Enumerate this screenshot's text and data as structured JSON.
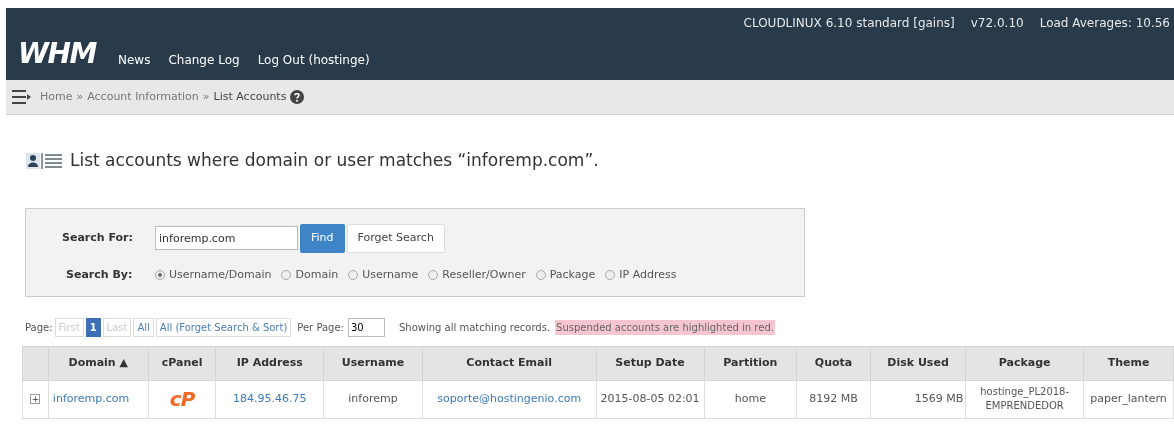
{
  "header": {
    "logo": "WHM",
    "nav": [
      "News",
      "Change Log",
      "Log Out (hostinge)"
    ],
    "server_info": [
      "CLOUDLINUX 6.10 standard [gains]",
      "v72.0.10",
      "Load Averages: 10.56"
    ]
  },
  "breadcrumb": {
    "items": [
      "Home",
      "Account Information",
      "List Accounts"
    ],
    "separator": "»"
  },
  "page_title": "List accounts where domain or user matches “inforemp.com”.",
  "search": {
    "label": "Search For:",
    "value": "inforemp.com",
    "find_button": "Find",
    "forget_button": "Forget Search",
    "by_label": "Search By:",
    "options": [
      {
        "label": "Username/Domain",
        "selected": true
      },
      {
        "label": "Domain",
        "selected": false
      },
      {
        "label": "Username",
        "selected": false
      },
      {
        "label": "Reseller/Owner",
        "selected": false
      },
      {
        "label": "Package",
        "selected": false
      },
      {
        "label": "IP Address",
        "selected": false
      }
    ]
  },
  "pagination": {
    "label": "Page:",
    "buttons": [
      {
        "label": "First",
        "disabled": true,
        "selected": false
      },
      {
        "label": "1",
        "disabled": false,
        "selected": true
      },
      {
        "label": "Last",
        "disabled": true,
        "selected": false
      },
      {
        "label": "All",
        "disabled": false,
        "selected": false
      },
      {
        "label": "All (Forget Search & Sort)",
        "disabled": false,
        "selected": false
      }
    ],
    "per_page_label": "Per Page:",
    "per_page": "30",
    "status": "Showing all matching records.",
    "suspended_note": "Suspended accounts are highlighted in red."
  },
  "table": {
    "columns": [
      "Domain ▲",
      "cPanel",
      "IP Address",
      "Username",
      "Contact Email",
      "Setup Date",
      "Partition",
      "Quota",
      "Disk Used",
      "Package",
      "Theme"
    ],
    "rows": [
      {
        "expand": "+",
        "domain": "inforemp.com",
        "cpanel_logo": "cP",
        "ip": "184.95.46.75",
        "username": "inforemp",
        "email": "soporte@hostingenio.com",
        "setup_date": "2015-08-05 02:01",
        "partition": "home",
        "quota": "8192 MB",
        "disk_used": "1569 MB",
        "package": "hostinge_PL2018-EMPRENDEDOR",
        "theme": "paper_lantern"
      }
    ]
  }
}
